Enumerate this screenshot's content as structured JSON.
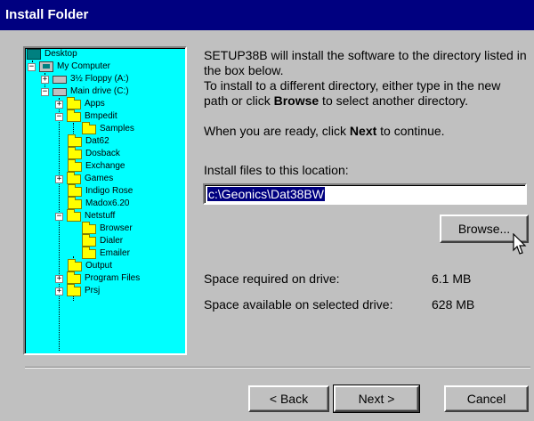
{
  "window": {
    "title": "Install Folder"
  },
  "tree": {
    "items": [
      {
        "label": "Desktop",
        "icon": "desktop-icon"
      },
      {
        "label": "My Computer",
        "icon": "computer-icon"
      },
      {
        "label": "3½ Floppy (A:)",
        "icon": "floppy-drive-icon"
      },
      {
        "label": "Main drive (C:)",
        "icon": "hard-drive-icon"
      },
      {
        "label": "Apps",
        "icon": "folder-icon"
      },
      {
        "label": "Bmpedit",
        "icon": "folder-icon"
      },
      {
        "label": "Samples",
        "icon": "folder-icon"
      },
      {
        "label": "Dat62",
        "icon": "folder-icon"
      },
      {
        "label": "Dosback",
        "icon": "folder-icon"
      },
      {
        "label": "Exchange",
        "icon": "folder-icon"
      },
      {
        "label": "Games",
        "icon": "folder-icon"
      },
      {
        "label": "Indigo Rose",
        "icon": "folder-icon"
      },
      {
        "label": "Madox6.20",
        "icon": "folder-icon"
      },
      {
        "label": "Netstuff",
        "icon": "folder-icon"
      },
      {
        "label": "Browser",
        "icon": "folder-icon"
      },
      {
        "label": "Dialer",
        "icon": "folder-icon"
      },
      {
        "label": "Emailer",
        "icon": "folder-icon"
      },
      {
        "label": "Output",
        "icon": "folder-icon"
      },
      {
        "label": "Program Files",
        "icon": "folder-icon"
      },
      {
        "label": "Prsj",
        "icon": "folder-icon"
      }
    ]
  },
  "message": {
    "line1": "SETUP38B will install the software to the directory listed in",
    "line2": "the box below.",
    "line3": "To install to a different directory, either type in the new",
    "line4_pre": "path or click ",
    "line4_bold": "Browse",
    "line4_post": " to select another directory.",
    "ready_pre": "When you are ready, click ",
    "ready_bold": "Next",
    "ready_post": " to continue."
  },
  "location": {
    "label": "Install files to this location:",
    "value": "c:\\Geonics\\Dat38BW"
  },
  "browse_label": "Browse...",
  "space": {
    "required_label": "Space required on drive:",
    "required_value": "6.1 MB",
    "available_label": "Space available on selected drive:",
    "available_value": "628 MB"
  },
  "buttons": {
    "back": "< Back",
    "next": "Next >",
    "cancel": "Cancel"
  },
  "colors": {
    "titlebar": "#000080",
    "tree_bg": "#00ffff",
    "dialog_bg": "#c0c0c0",
    "selection": "#000080"
  }
}
